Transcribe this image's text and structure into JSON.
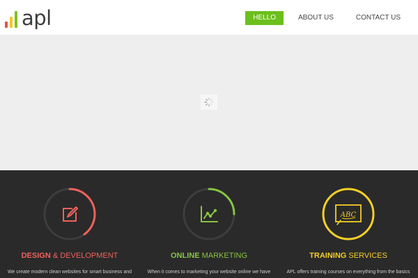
{
  "brand": {
    "name": "apl",
    "colors": {
      "red": "#e5504b",
      "yellow": "#f4c81f",
      "green": "#7fc122"
    }
  },
  "nav": {
    "items": [
      {
        "label": "HELLO",
        "active": true
      },
      {
        "label": "ABOUT US",
        "active": false
      },
      {
        "label": "CONTACT US",
        "active": false
      }
    ],
    "accent": "#6cbf1c"
  },
  "hero": {
    "loader_icon": "spinner-icon"
  },
  "services": [
    {
      "title_strong": "DESIGN",
      "title_rest": " & DEVELOPMENT",
      "icon": "edit-icon",
      "progress": 0.4,
      "color": "#f0625b",
      "description": "We create modern clean websites for smart business and"
    },
    {
      "title_strong": "ONLINE",
      "title_rest": " MARKETING",
      "icon": "chart-icon",
      "progress": 0.25,
      "color": "#86c540",
      "description": "When it comes to marketing your website online we have"
    },
    {
      "title_strong": "TRAINING",
      "title_rest": " SERVICES",
      "icon": "abc-board-icon",
      "progress": 1.0,
      "color": "#f6cf26",
      "description": "APL offers training courses on everything from the basics"
    }
  ]
}
